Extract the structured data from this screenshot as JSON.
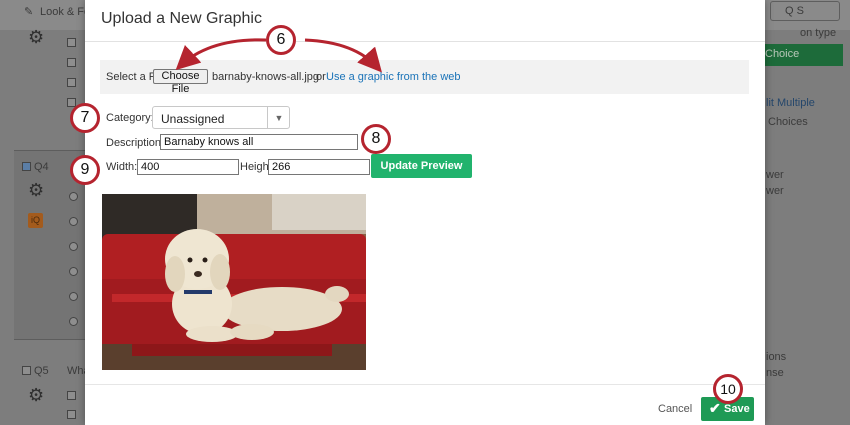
{
  "background": {
    "menu": "Look & Feel",
    "search": "Q S",
    "q4": "Q4",
    "q5": "Q5",
    "q5_text": "Wha",
    "right": {
      "type_label": "on type",
      "choice": "Choice",
      "edit_multiple": "lit Multiple",
      "choices": "Choices",
      "answer1": "wer",
      "answer2": "wer",
      "actions": "ions",
      "response": "nse"
    }
  },
  "modal": {
    "title": "Upload a New Graphic",
    "source": {
      "select_file_label": "Select a File",
      "choose_file": "Choose File",
      "file_name": "barnaby-knows-all.jpg",
      "or": "or",
      "web_link": "Use a graphic from the web"
    },
    "category": {
      "label": "Category:",
      "value": "Unassigned"
    },
    "description": {
      "label": "Description:",
      "value": "Barnaby knows all"
    },
    "width": {
      "label": "Width:",
      "value": "400"
    },
    "height": {
      "label": "Height:",
      "value": "266"
    },
    "update_preview": "Update Preview",
    "footer": {
      "cancel": "Cancel",
      "save": "Save"
    }
  },
  "annotations": {
    "c6": "6",
    "c7": "7",
    "c8": "8",
    "c9": "9",
    "c10": "10"
  },
  "colors": {
    "accent_red": "#b5242f",
    "save_green": "#1e9a55",
    "preview_green": "#21b36d",
    "link_blue": "#1a73b8"
  }
}
